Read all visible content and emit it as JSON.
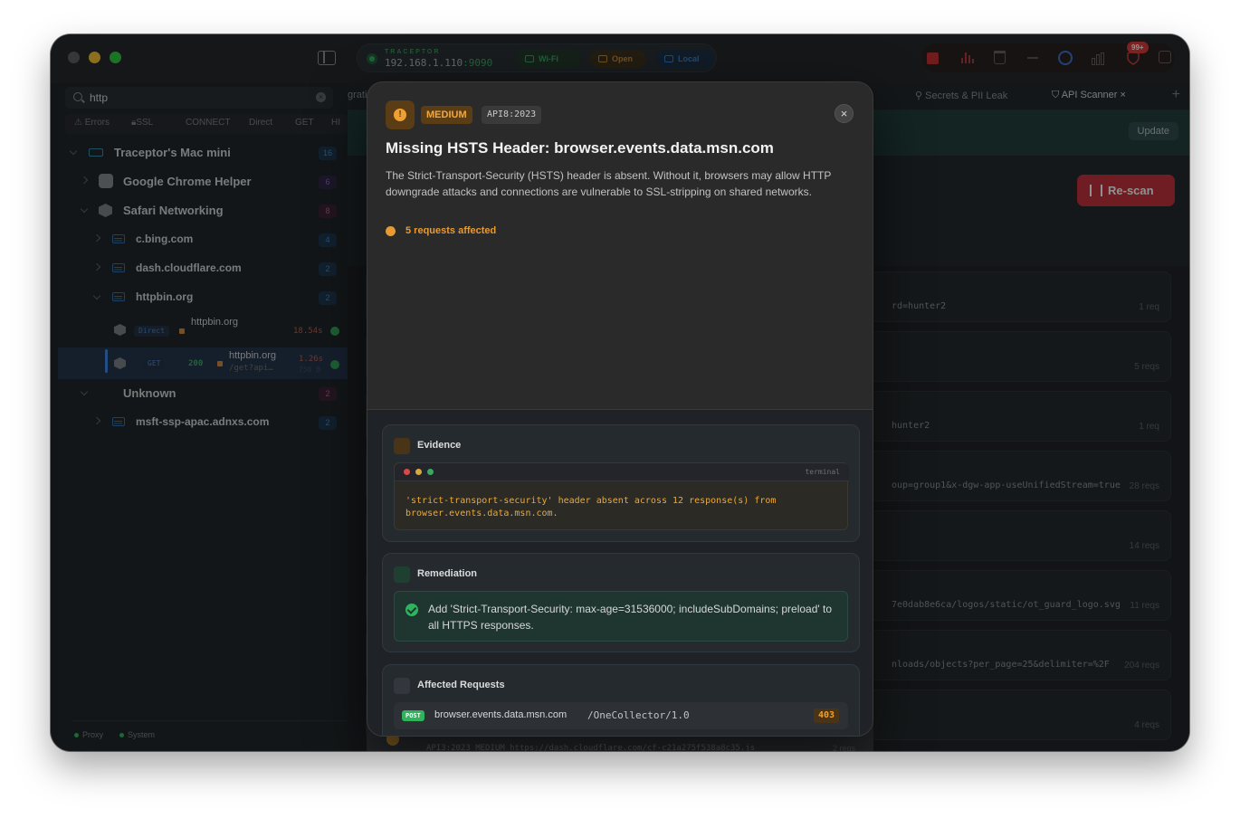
{
  "window": {
    "status": {
      "app_name": "TRACEPTOR",
      "ip": "192.168.1.110",
      "port": ":9090",
      "wifi": "Wi-Fi",
      "open": "Open",
      "local": "Local"
    },
    "badge": "99+"
  },
  "sidebar": {
    "search": {
      "value": "http"
    },
    "filters": [
      "Errors",
      "SSL",
      "CONNECT",
      "Direct",
      "GET",
      "HI"
    ],
    "tree": {
      "root": {
        "label": "Traceptor's Mac mini",
        "count": "16"
      },
      "chrome": {
        "label": "Google Chrome Helper",
        "count": "6"
      },
      "safari": {
        "label": "Safari Networking",
        "count": "8"
      },
      "bing": {
        "label": "c.bing.com",
        "count": "4"
      },
      "cloudflare": {
        "label": "dash.cloudflare.com",
        "count": "2"
      },
      "httpbin": {
        "label": "httpbin.org",
        "count": "2"
      },
      "req1": {
        "method": "Direct",
        "host": "httpbin.org",
        "time": "18.54s"
      },
      "req2": {
        "method": "GET",
        "code": "200",
        "host": "httpbin.org",
        "path": "/get?api…",
        "time": "1.26s",
        "size": "750 B"
      },
      "unknown": {
        "label": "Unknown",
        "count": "2"
      },
      "adnxs": {
        "label": "msft-ssp-apac.adnxs.com",
        "count": "2"
      }
    },
    "footer": {
      "proxy": "Proxy",
      "system": "System"
    }
  },
  "main": {
    "tabs": {
      "partial": "grati",
      "secrets": "Secrets & PII Leak",
      "scanner": "API Scanner"
    },
    "update_label": "Update",
    "rescan_label": "Re-scan",
    "cards": [
      {
        "url": "rd=hunter2",
        "reqs": "1 req"
      },
      {
        "url": "",
        "reqs": "5 reqs"
      },
      {
        "url": "hunter2",
        "reqs": "1 req"
      },
      {
        "url": "oup=group1&x-dgw-app-useUnifiedStream=true",
        "reqs": "28 reqs"
      },
      {
        "url": "",
        "reqs": "14 reqs"
      },
      {
        "url": "7e0dab8e6ca/logos/static/ot_guard_logo.svg",
        "reqs": "11 reqs"
      },
      {
        "url": "nloads/objects?per_page=25&delimiter=%2F",
        "reqs": "204 reqs"
      },
      {
        "url": "",
        "reqs": "4 reqs"
      }
    ],
    "bottom_card": {
      "tag": "API3:2023",
      "severity": "MEDIUM",
      "url": "https://dash.cloudflare.com/cf-c21a275f538a8c35.js",
      "reqs": "2 reqs"
    }
  },
  "modal": {
    "severity": "MEDIUM",
    "owasp": "API8:2023",
    "title": "Missing HSTS Header: browser.events.data.msn.com",
    "description": "The Strict-Transport-Security (HSTS) header is absent. Without it, browsers may allow HTTP downgrade attacks and connections are vulnerable to SSL-stripping on shared networks.",
    "affected_label": "5 requests affected",
    "evidence": {
      "heading": "Evidence",
      "terminal_label": "terminal",
      "text": "'strict-transport-security' header absent across 12 response(s) from browser.events.data.msn.com."
    },
    "remediation": {
      "heading": "Remediation",
      "text": "Add 'Strict-Transport-Security: max-age=31536000; includeSubDomains; preload' to all HTTPS responses."
    },
    "affected_requests": {
      "heading": "Affected Requests",
      "rows": [
        {
          "method": "POST",
          "host": "browser.events.data.msn.com",
          "path": "/OneCollector/1.0",
          "code": "403"
        }
      ]
    }
  }
}
